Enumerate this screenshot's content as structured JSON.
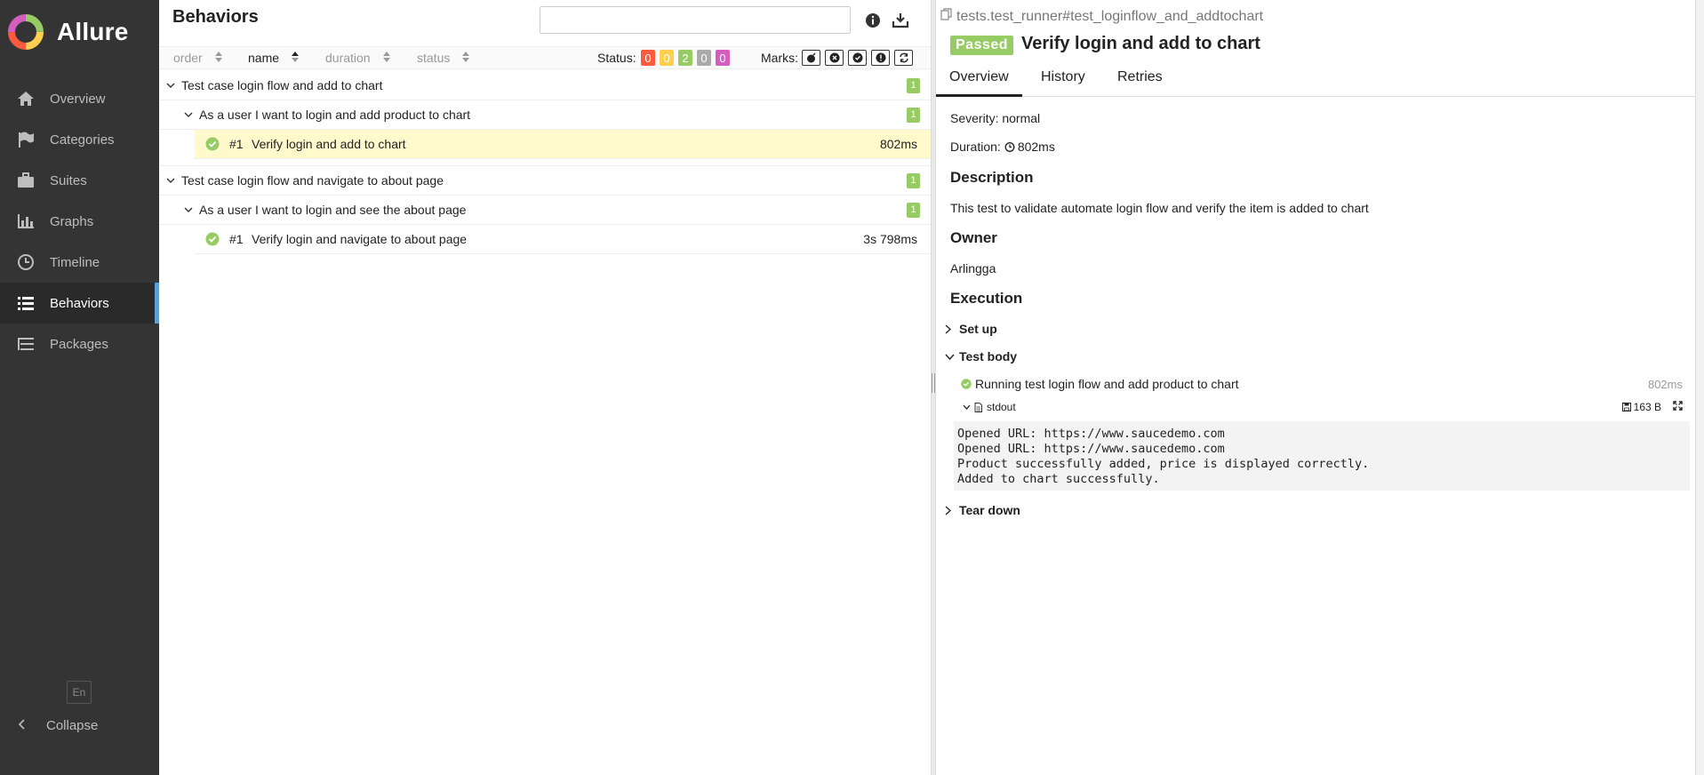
{
  "brand": {
    "name": "Allure"
  },
  "sidebar": {
    "items": [
      {
        "label": "Overview",
        "icon": "home-icon"
      },
      {
        "label": "Categories",
        "icon": "flag-icon"
      },
      {
        "label": "Suites",
        "icon": "briefcase-icon"
      },
      {
        "label": "Graphs",
        "icon": "bar-chart-icon"
      },
      {
        "label": "Timeline",
        "icon": "clock-icon"
      },
      {
        "label": "Behaviors",
        "icon": "list-icon",
        "active": true
      },
      {
        "label": "Packages",
        "icon": "packages-icon"
      }
    ],
    "language": "En",
    "collapse_label": "Collapse"
  },
  "tree_pane": {
    "title": "Behaviors",
    "search_value": "",
    "sort": {
      "order": "order",
      "name": "name",
      "duration": "duration",
      "status": "status"
    },
    "status_label": "Status:",
    "status_counts": [
      {
        "value": "0",
        "color": "#fd5a3e"
      },
      {
        "value": "0",
        "color": "#ffd050"
      },
      {
        "value": "2",
        "color": "#97cc64"
      },
      {
        "value": "0",
        "color": "#aaaaaa"
      },
      {
        "value": "0",
        "color": "#d35ebe"
      }
    ],
    "marks_label": "Marks:",
    "groups": [
      {
        "label": "Test case login flow and add to chart",
        "count": "1",
        "story": {
          "label": "As a user I want to login and add product to chart",
          "count": "1",
          "test": {
            "num": "#1",
            "label": "Verify login and add to chart",
            "duration": "802ms"
          }
        }
      },
      {
        "label": "Test case login flow and navigate to about page",
        "count": "1",
        "story": {
          "label": "As a user I want to login and see the about page",
          "count": "1",
          "test": {
            "num": "#1",
            "label": "Verify login and navigate to about page",
            "duration": "3s 798ms"
          }
        }
      }
    ]
  },
  "detail": {
    "full_name": "tests.test_runner#test_loginflow_and_addtochart",
    "status": "Passed",
    "status_color": "#97cc64",
    "title": "Verify login and add to chart",
    "tabs": [
      "Overview",
      "History",
      "Retries"
    ],
    "severity": "Severity: normal",
    "duration_label": "Duration:",
    "duration": "802ms",
    "description_heading": "Description",
    "description": "This test to validate automate login flow and verify the item is added to chart",
    "owner_heading": "Owner",
    "owner": "Arlingga",
    "execution_heading": "Execution",
    "setup_label": "Set up",
    "body_label": "Test body",
    "step_label": "Running test login flow and add product to chart",
    "step_duration": "802ms",
    "attachment_name": "stdout",
    "attachment_size": "163 B",
    "stdout": "Opened URL: https://www.saucedemo.com\nOpened URL: https://www.saucedemo.com\nProduct successfully added, price is displayed correctly.\nAdded to chart successfully.",
    "teardown_label": "Tear down"
  }
}
